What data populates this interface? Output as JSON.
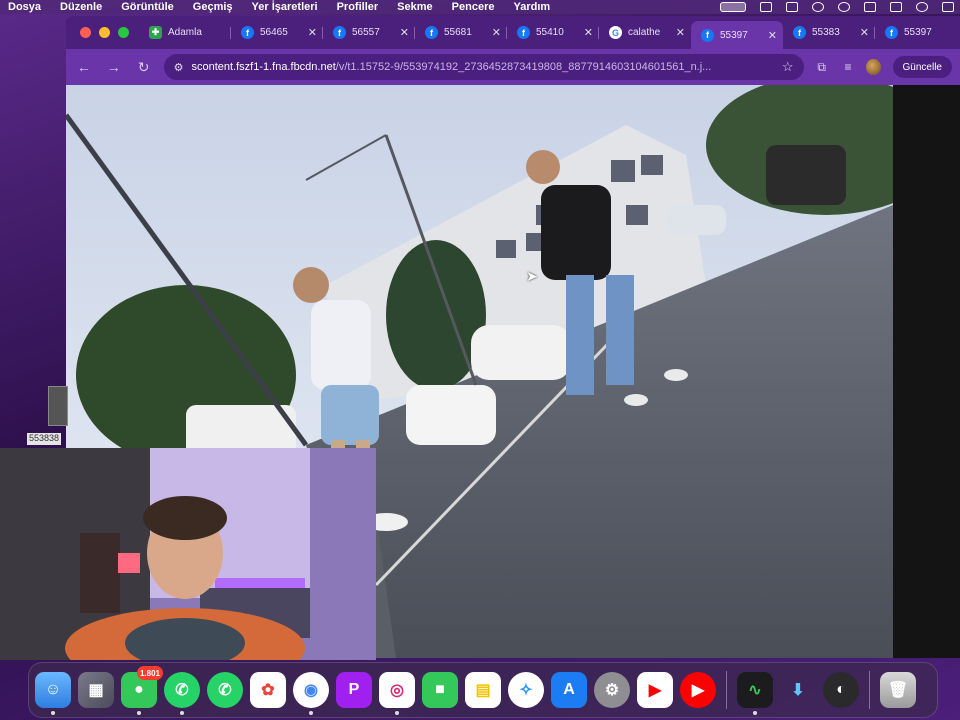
{
  "menubar": {
    "items": [
      "Dosya",
      "Düzenle",
      "Görüntüle",
      "Geçmiş",
      "Yer İşaretleri",
      "Profiller",
      "Sekme",
      "Pencere",
      "Yardım"
    ]
  },
  "tabs": [
    {
      "favicon": "green-app-icon",
      "title": "Adamla"
    },
    {
      "favicon": "facebook-icon",
      "title": "56465"
    },
    {
      "favicon": "facebook-icon",
      "title": "56557"
    },
    {
      "favicon": "facebook-icon",
      "title": "55681"
    },
    {
      "favicon": "facebook-icon",
      "title": "55410"
    },
    {
      "favicon": "google-icon",
      "title": "calathe"
    },
    {
      "favicon": "facebook-icon",
      "title": "55397"
    },
    {
      "favicon": "facebook-icon",
      "title": "55383"
    },
    {
      "favicon": "facebook-icon",
      "title": "55397"
    }
  ],
  "omnibox": {
    "host": "scontent.fszf1-1.fna.fbcdn.net",
    "path": "/v/t1.15752-9/553974192_2736452873419808_8877914603104601561_n.j..."
  },
  "toolbar": {
    "update_label": "Güncelle"
  },
  "thumbnail_label": "553838",
  "dock": {
    "messages_badge": "1.801"
  },
  "colors": {
    "accent": "#6a35a8",
    "tabbar": "#4b1f7c"
  }
}
